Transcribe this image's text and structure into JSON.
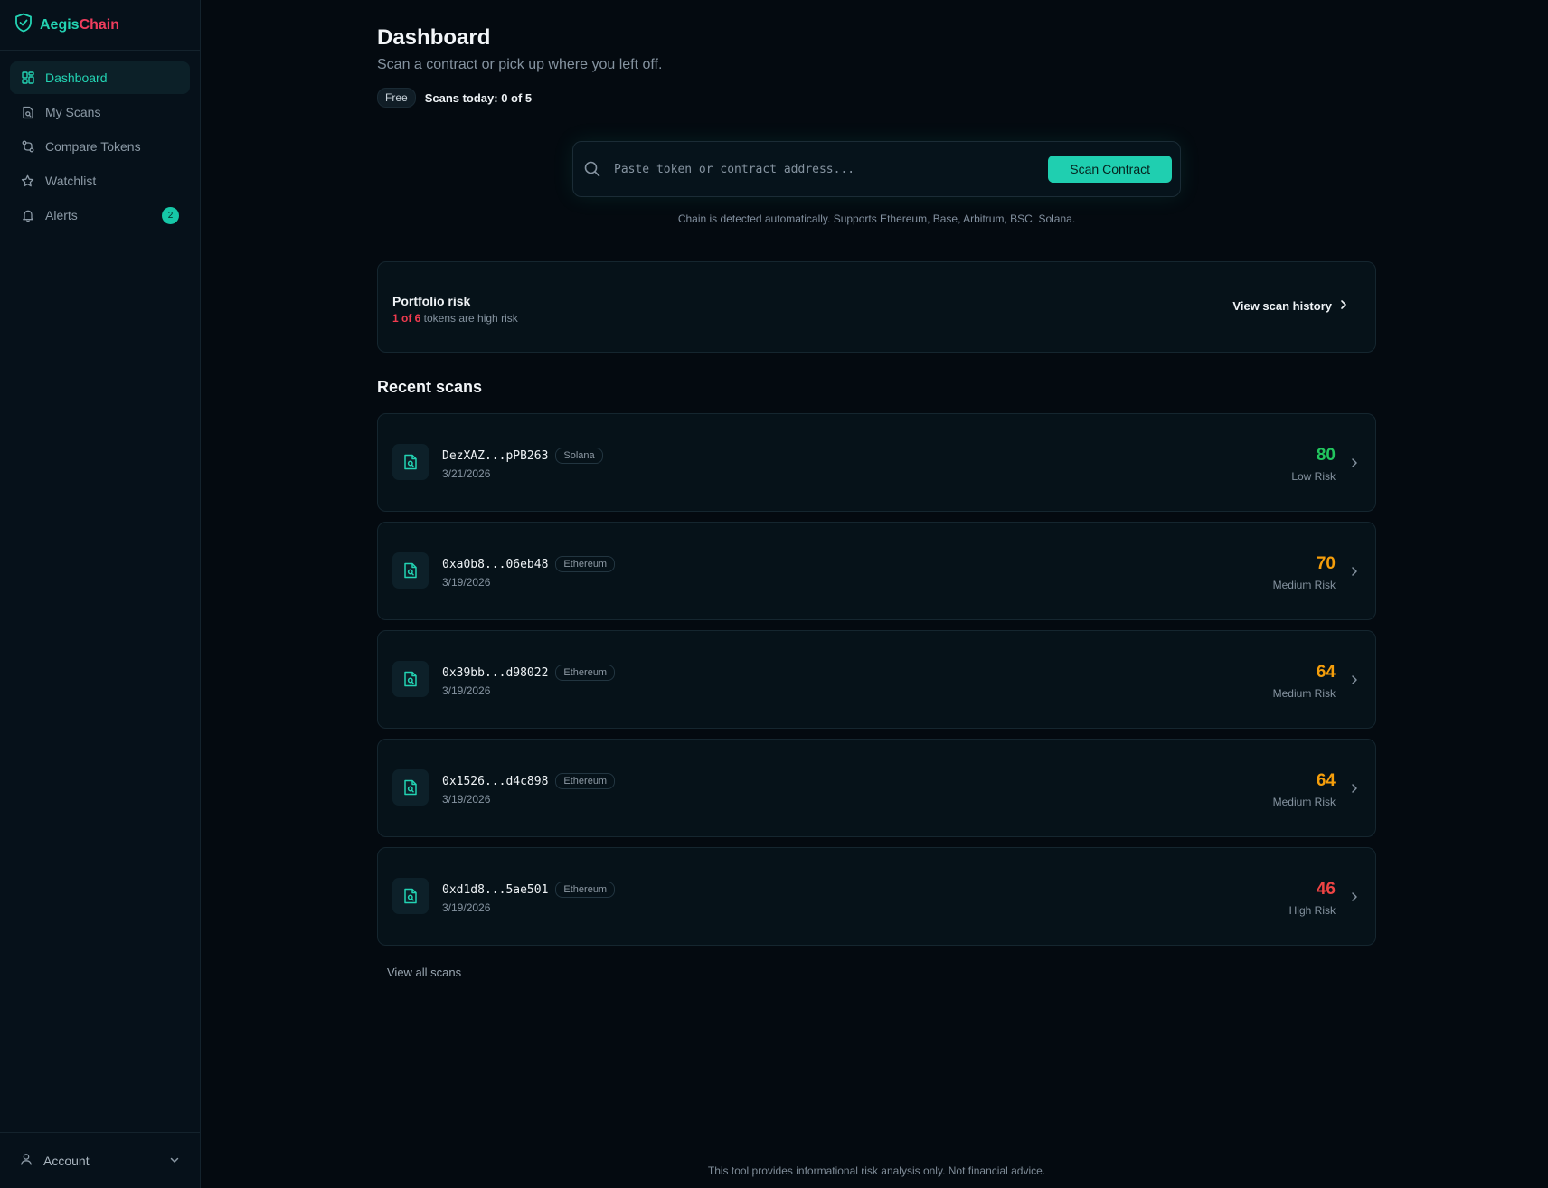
{
  "brand": {
    "part1": "Aegis",
    "part2": "Chain",
    "accent": "#23d3b3",
    "accent2": "#ef3d5d"
  },
  "sidebar": {
    "items": [
      {
        "label": "Dashboard",
        "icon": "grid-icon",
        "active": true
      },
      {
        "label": "My Scans",
        "icon": "file-search-icon"
      },
      {
        "label": "Compare Tokens",
        "icon": "compare-icon"
      },
      {
        "label": "Watchlist",
        "icon": "star-icon"
      },
      {
        "label": "Alerts",
        "icon": "bell-icon",
        "badge": "2"
      }
    ],
    "account_label": "Account"
  },
  "header": {
    "title": "Dashboard",
    "subtitle": "Scan a contract or pick up where you left off.",
    "plan": "Free",
    "scans_today": "Scans today: 0 of 5"
  },
  "search": {
    "placeholder": "Paste token or contract address...",
    "button_label": "Scan Contract",
    "note": "Chain is detected automatically. Supports Ethereum, Base, Arbitrum, BSC, Solana."
  },
  "portfolio": {
    "title": "Portfolio risk",
    "high_risk_count": "1 of 6",
    "sub_rest": " tokens are high risk",
    "link": "View scan history"
  },
  "recent": {
    "title": "Recent scans",
    "scans": [
      {
        "address": "DezXAZ...pPB263",
        "chain": "Solana",
        "date": "3/21/2026",
        "score": "80",
        "risk": "Low Risk",
        "color": "#22c55e"
      },
      {
        "address": "0xa0b8...06eb48",
        "chain": "Ethereum",
        "date": "3/19/2026",
        "score": "70",
        "risk": "Medium Risk",
        "color": "#f59e0b"
      },
      {
        "address": "0x39bb...d98022",
        "chain": "Ethereum",
        "date": "3/19/2026",
        "score": "64",
        "risk": "Medium Risk",
        "color": "#f59e0b"
      },
      {
        "address": "0x1526...d4c898",
        "chain": "Ethereum",
        "date": "3/19/2026",
        "score": "64",
        "risk": "Medium Risk",
        "color": "#f59e0b"
      },
      {
        "address": "0xd1d8...5ae501",
        "chain": "Ethereum",
        "date": "3/19/2026",
        "score": "46",
        "risk": "High Risk",
        "color": "#ef4444"
      }
    ],
    "view_all": "View all scans"
  },
  "footer": {
    "note": "This tool provides informational risk analysis only. Not financial advice."
  }
}
